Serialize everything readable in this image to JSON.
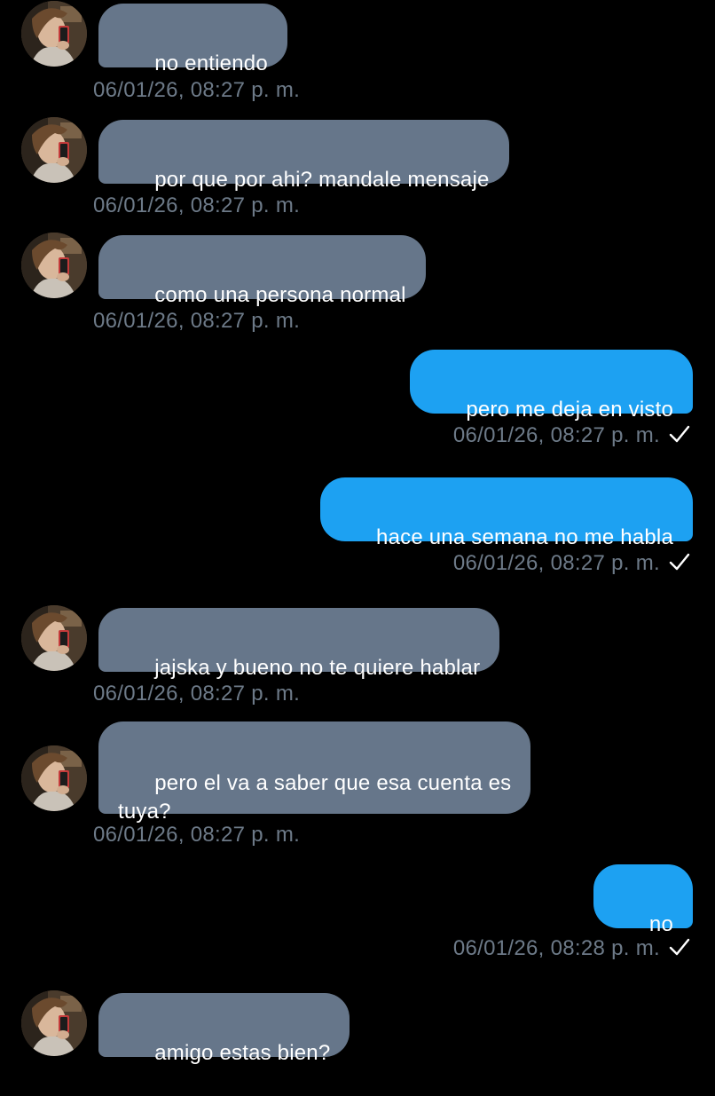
{
  "colors": {
    "background": "#000000",
    "incoming_bubble": "#66768a",
    "outgoing_bubble": "#1da1f2",
    "timestamp": "#6d7a88",
    "text": "#ffffff"
  },
  "messages": [
    {
      "direction": "incoming",
      "text": "no entiendo",
      "timestamp": "06/01/26, 08:27 p. m."
    },
    {
      "direction": "incoming",
      "text": "por que por ahi? mandale mensaje",
      "timestamp": "06/01/26, 08:27 p. m."
    },
    {
      "direction": "incoming",
      "text": "como una persona normal",
      "timestamp": "06/01/26, 08:27 p. m."
    },
    {
      "direction": "outgoing",
      "text": "pero me deja en visto",
      "timestamp": "06/01/26, 08:27 p. m.",
      "status_icon": "check-icon"
    },
    {
      "direction": "outgoing",
      "text": "hace una semana no me habla",
      "timestamp": "06/01/26, 08:27 p. m.",
      "status_icon": "check-icon"
    },
    {
      "direction": "incoming",
      "text": "jajska y bueno no te quiere hablar",
      "timestamp": "06/01/26, 08:27 p. m."
    },
    {
      "direction": "incoming",
      "text": "pero el va a saber que esa cuenta es\ntuya?",
      "timestamp": "06/01/26, 08:27 p. m."
    },
    {
      "direction": "outgoing",
      "text": "no",
      "timestamp": "06/01/26, 08:28 p. m.",
      "status_icon": "check-icon"
    },
    {
      "direction": "incoming",
      "text": "amigo estas bien?",
      "timestamp": ""
    }
  ]
}
